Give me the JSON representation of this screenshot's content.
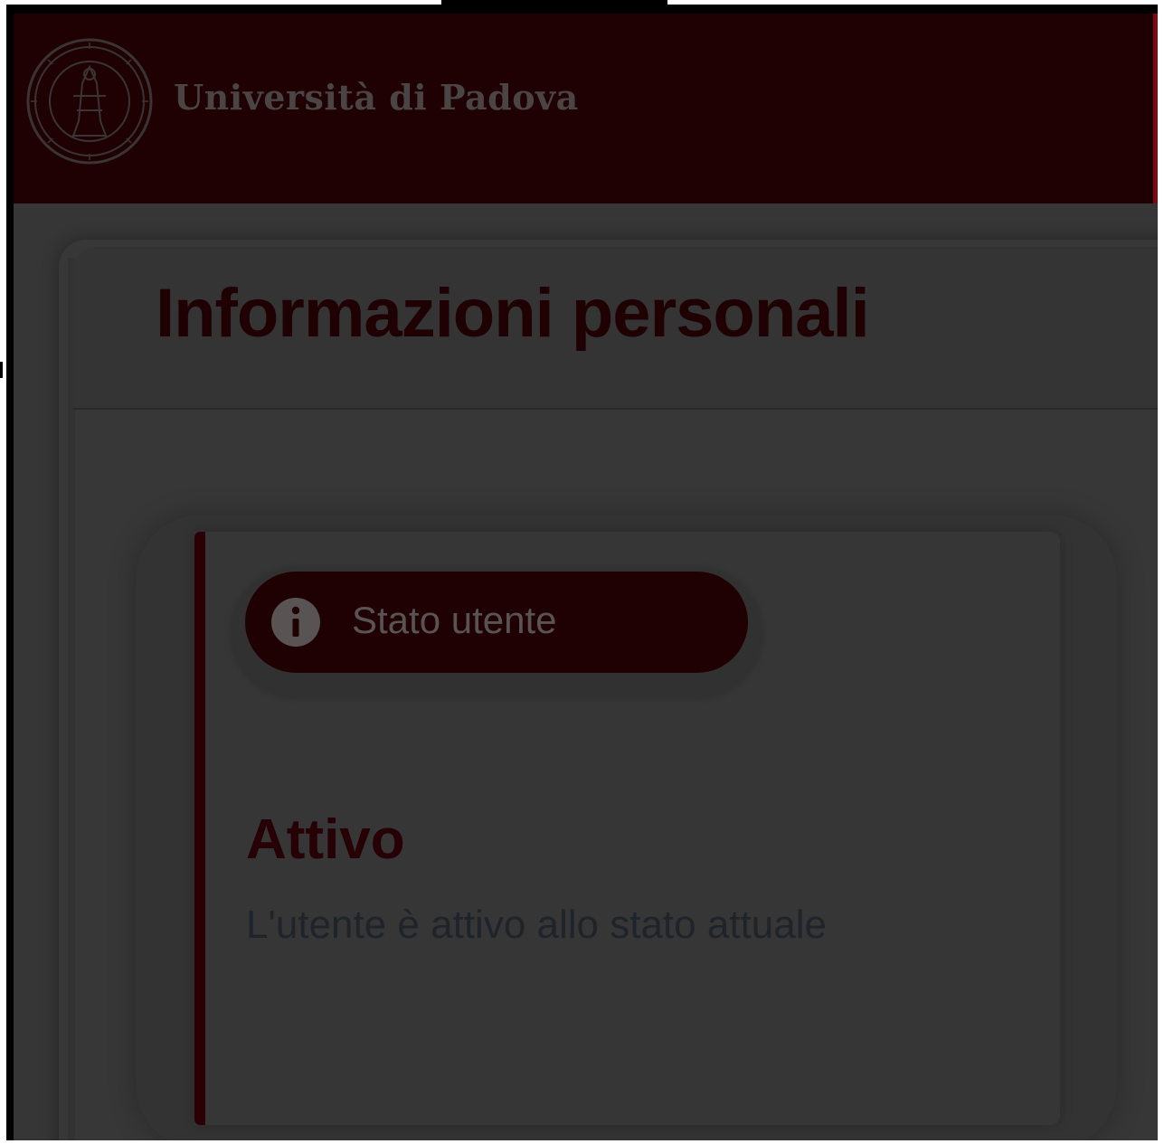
{
  "header": {
    "university_name": "Università di Padova",
    "logo_icon": "university-seal-icon"
  },
  "page": {
    "title": "Informazioni personali"
  },
  "status_card": {
    "pill_label": "Stato utente",
    "pill_icon": "info-icon",
    "heading": "Attivo",
    "description": "L'utente è attivo allo stato attuale"
  },
  "colors": {
    "brand_dark_red": "#1f0003",
    "overlay_gray": "#363636",
    "accent_red": "#7a0a14"
  }
}
